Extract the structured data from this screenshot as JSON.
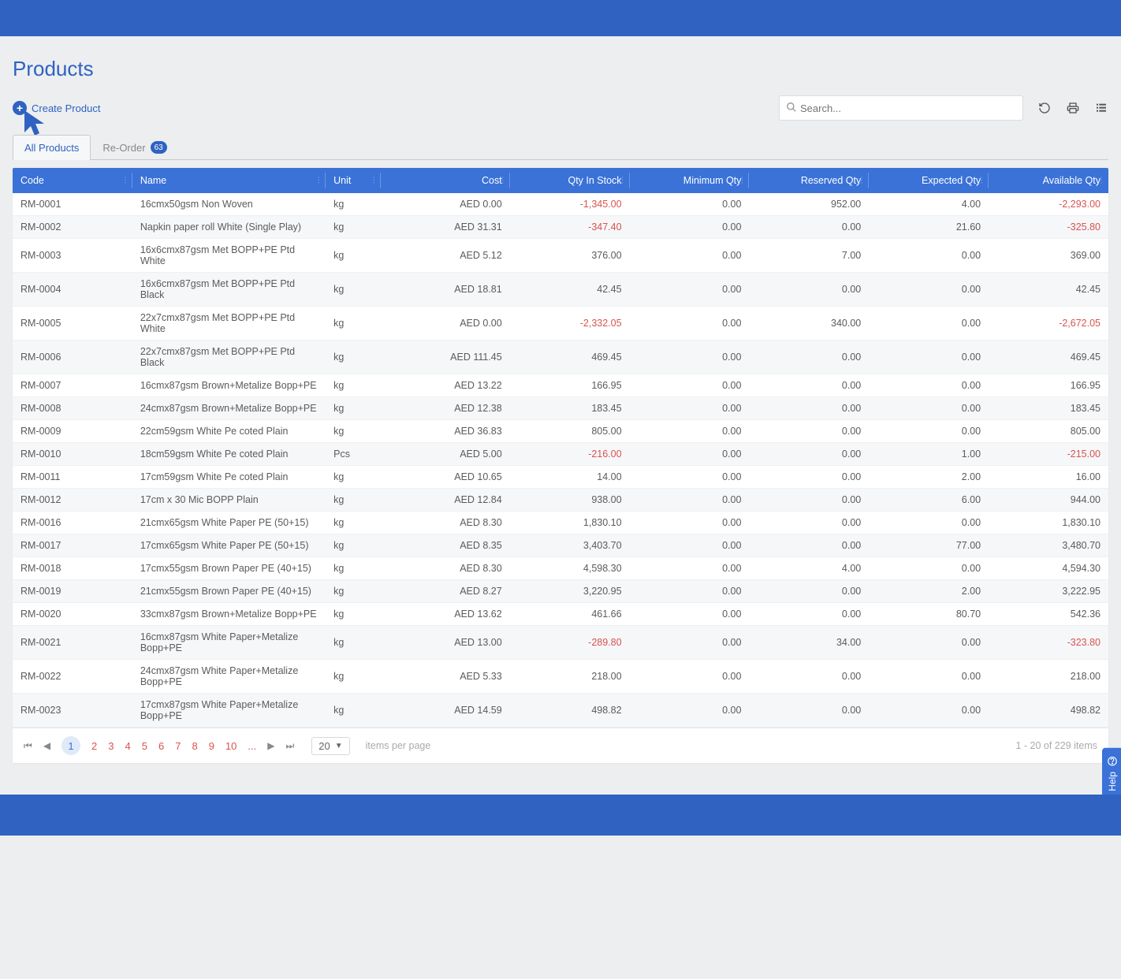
{
  "header": {
    "title": "Products"
  },
  "actions": {
    "create_label": "Create Product"
  },
  "search": {
    "placeholder": "Search..."
  },
  "tabs": [
    {
      "label": "All Products",
      "active": true
    },
    {
      "label": "Re-Order",
      "badge": "63",
      "active": false
    }
  ],
  "columns": [
    {
      "key": "code",
      "label": "Code",
      "align": "left"
    },
    {
      "key": "name",
      "label": "Name",
      "align": "left"
    },
    {
      "key": "unit",
      "label": "Unit",
      "align": "left"
    },
    {
      "key": "cost",
      "label": "Cost",
      "align": "right"
    },
    {
      "key": "qty_in_stock",
      "label": "Qty In Stock",
      "align": "right"
    },
    {
      "key": "minimum_qty",
      "label": "Minimum Qty",
      "align": "right"
    },
    {
      "key": "reserved_qty",
      "label": "Reserved Qty",
      "align": "right"
    },
    {
      "key": "expected_qty",
      "label": "Expected Qty",
      "align": "right"
    },
    {
      "key": "available_qty",
      "label": "Available Qty",
      "align": "right"
    }
  ],
  "rows": [
    {
      "code": "RM-0001",
      "name": "16cmx50gsm Non Woven",
      "unit": "kg",
      "cost": "AED 0.00",
      "qty_in_stock": "-1,345.00",
      "minimum_qty": "0.00",
      "reserved_qty": "952.00",
      "expected_qty": "4.00",
      "available_qty": "-2,293.00",
      "neg_stock": true,
      "neg_avail": true
    },
    {
      "code": "RM-0002",
      "name": "Napkin paper roll White (Single Play)",
      "unit": "kg",
      "cost": "AED 31.31",
      "qty_in_stock": "-347.40",
      "minimum_qty": "0.00",
      "reserved_qty": "0.00",
      "expected_qty": "21.60",
      "available_qty": "-325.80",
      "neg_stock": true,
      "neg_avail": true
    },
    {
      "code": "RM-0003",
      "name": "16x6cmx87gsm Met BOPP+PE Ptd White",
      "unit": "kg",
      "cost": "AED 5.12",
      "qty_in_stock": "376.00",
      "minimum_qty": "0.00",
      "reserved_qty": "7.00",
      "expected_qty": "0.00",
      "available_qty": "369.00"
    },
    {
      "code": "RM-0004",
      "name": "16x6cmx87gsm Met BOPP+PE Ptd Black",
      "unit": "kg",
      "cost": "AED 18.81",
      "qty_in_stock": "42.45",
      "minimum_qty": "0.00",
      "reserved_qty": "0.00",
      "expected_qty": "0.00",
      "available_qty": "42.45"
    },
    {
      "code": "RM-0005",
      "name": "22x7cmx87gsm Met BOPP+PE Ptd White",
      "unit": "kg",
      "cost": "AED 0.00",
      "qty_in_stock": "-2,332.05",
      "minimum_qty": "0.00",
      "reserved_qty": "340.00",
      "expected_qty": "0.00",
      "available_qty": "-2,672.05",
      "neg_stock": true,
      "neg_avail": true
    },
    {
      "code": "RM-0006",
      "name": "22x7cmx87gsm Met BOPP+PE Ptd Black",
      "unit": "kg",
      "cost": "AED 111.45",
      "qty_in_stock": "469.45",
      "minimum_qty": "0.00",
      "reserved_qty": "0.00",
      "expected_qty": "0.00",
      "available_qty": "469.45"
    },
    {
      "code": "RM-0007",
      "name": "16cmx87gsm Brown+Metalize Bopp+PE",
      "unit": "kg",
      "cost": "AED 13.22",
      "qty_in_stock": "166.95",
      "minimum_qty": "0.00",
      "reserved_qty": "0.00",
      "expected_qty": "0.00",
      "available_qty": "166.95"
    },
    {
      "code": "RM-0008",
      "name": "24cmx87gsm Brown+Metalize Bopp+PE",
      "unit": "kg",
      "cost": "AED 12.38",
      "qty_in_stock": "183.45",
      "minimum_qty": "0.00",
      "reserved_qty": "0.00",
      "expected_qty": "0.00",
      "available_qty": "183.45"
    },
    {
      "code": "RM-0009",
      "name": "22cm59gsm White Pe coted Plain",
      "unit": "kg",
      "cost": "AED 36.83",
      "qty_in_stock": "805.00",
      "minimum_qty": "0.00",
      "reserved_qty": "0.00",
      "expected_qty": "0.00",
      "available_qty": "805.00"
    },
    {
      "code": "RM-0010",
      "name": "18cm59gsm White Pe coted Plain",
      "unit": "Pcs",
      "cost": "AED 5.00",
      "qty_in_stock": "-216.00",
      "minimum_qty": "0.00",
      "reserved_qty": "0.00",
      "expected_qty": "1.00",
      "available_qty": "-215.00",
      "neg_stock": true,
      "neg_avail": true
    },
    {
      "code": "RM-0011",
      "name": "17cm59gsm White Pe coted Plain",
      "unit": "kg",
      "cost": "AED 10.65",
      "qty_in_stock": "14.00",
      "minimum_qty": "0.00",
      "reserved_qty": "0.00",
      "expected_qty": "2.00",
      "available_qty": "16.00"
    },
    {
      "code": "RM-0012",
      "name": "17cm x 30 Mic BOPP Plain",
      "unit": "kg",
      "cost": "AED 12.84",
      "qty_in_stock": "938.00",
      "minimum_qty": "0.00",
      "reserved_qty": "0.00",
      "expected_qty": "6.00",
      "available_qty": "944.00"
    },
    {
      "code": "RM-0016",
      "name": "21cmx65gsm White Paper PE (50+15)",
      "unit": "kg",
      "cost": "AED 8.30",
      "qty_in_stock": "1,830.10",
      "minimum_qty": "0.00",
      "reserved_qty": "0.00",
      "expected_qty": "0.00",
      "available_qty": "1,830.10"
    },
    {
      "code": "RM-0017",
      "name": "17cmx65gsm White Paper PE (50+15)",
      "unit": "kg",
      "cost": "AED 8.35",
      "qty_in_stock": "3,403.70",
      "minimum_qty": "0.00",
      "reserved_qty": "0.00",
      "expected_qty": "77.00",
      "available_qty": "3,480.70"
    },
    {
      "code": "RM-0018",
      "name": "17cmx55gsm Brown Paper PE (40+15)",
      "unit": "kg",
      "cost": "AED 8.30",
      "qty_in_stock": "4,598.30",
      "minimum_qty": "0.00",
      "reserved_qty": "4.00",
      "expected_qty": "0.00",
      "available_qty": "4,594.30"
    },
    {
      "code": "RM-0019",
      "name": "21cmx55gsm Brown Paper PE (40+15)",
      "unit": "kg",
      "cost": "AED 8.27",
      "qty_in_stock": "3,220.95",
      "minimum_qty": "0.00",
      "reserved_qty": "0.00",
      "expected_qty": "2.00",
      "available_qty": "3,222.95"
    },
    {
      "code": "RM-0020",
      "name": "33cmx87gsm Brown+Metalize Bopp+PE",
      "unit": "kg",
      "cost": "AED 13.62",
      "qty_in_stock": "461.66",
      "minimum_qty": "0.00",
      "reserved_qty": "0.00",
      "expected_qty": "80.70",
      "available_qty": "542.36"
    },
    {
      "code": "RM-0021",
      "name": "16cmx87gsm White Paper+Metalize Bopp+PE",
      "unit": "kg",
      "cost": "AED 13.00",
      "qty_in_stock": "-289.80",
      "minimum_qty": "0.00",
      "reserved_qty": "34.00",
      "expected_qty": "0.00",
      "available_qty": "-323.80",
      "neg_stock": true,
      "neg_avail": true
    },
    {
      "code": "RM-0022",
      "name": "24cmx87gsm White Paper+Metalize Bopp+PE",
      "unit": "kg",
      "cost": "AED 5.33",
      "qty_in_stock": "218.00",
      "minimum_qty": "0.00",
      "reserved_qty": "0.00",
      "expected_qty": "0.00",
      "available_qty": "218.00"
    },
    {
      "code": "RM-0023",
      "name": "17cmx87gsm White Paper+Metalize Bopp+PE",
      "unit": "kg",
      "cost": "AED 14.59",
      "qty_in_stock": "498.82",
      "minimum_qty": "0.00",
      "reserved_qty": "0.00",
      "expected_qty": "0.00",
      "available_qty": "498.82"
    }
  ],
  "pager": {
    "current_page": 1,
    "pages": [
      "1",
      "2",
      "3",
      "4",
      "5",
      "6",
      "7",
      "8",
      "9",
      "10"
    ],
    "ellipsis": "...",
    "page_size": "20",
    "items_per_page_label": "items per page",
    "range_label": "1 - 20 of 229 items"
  },
  "help": {
    "label": "Help"
  }
}
